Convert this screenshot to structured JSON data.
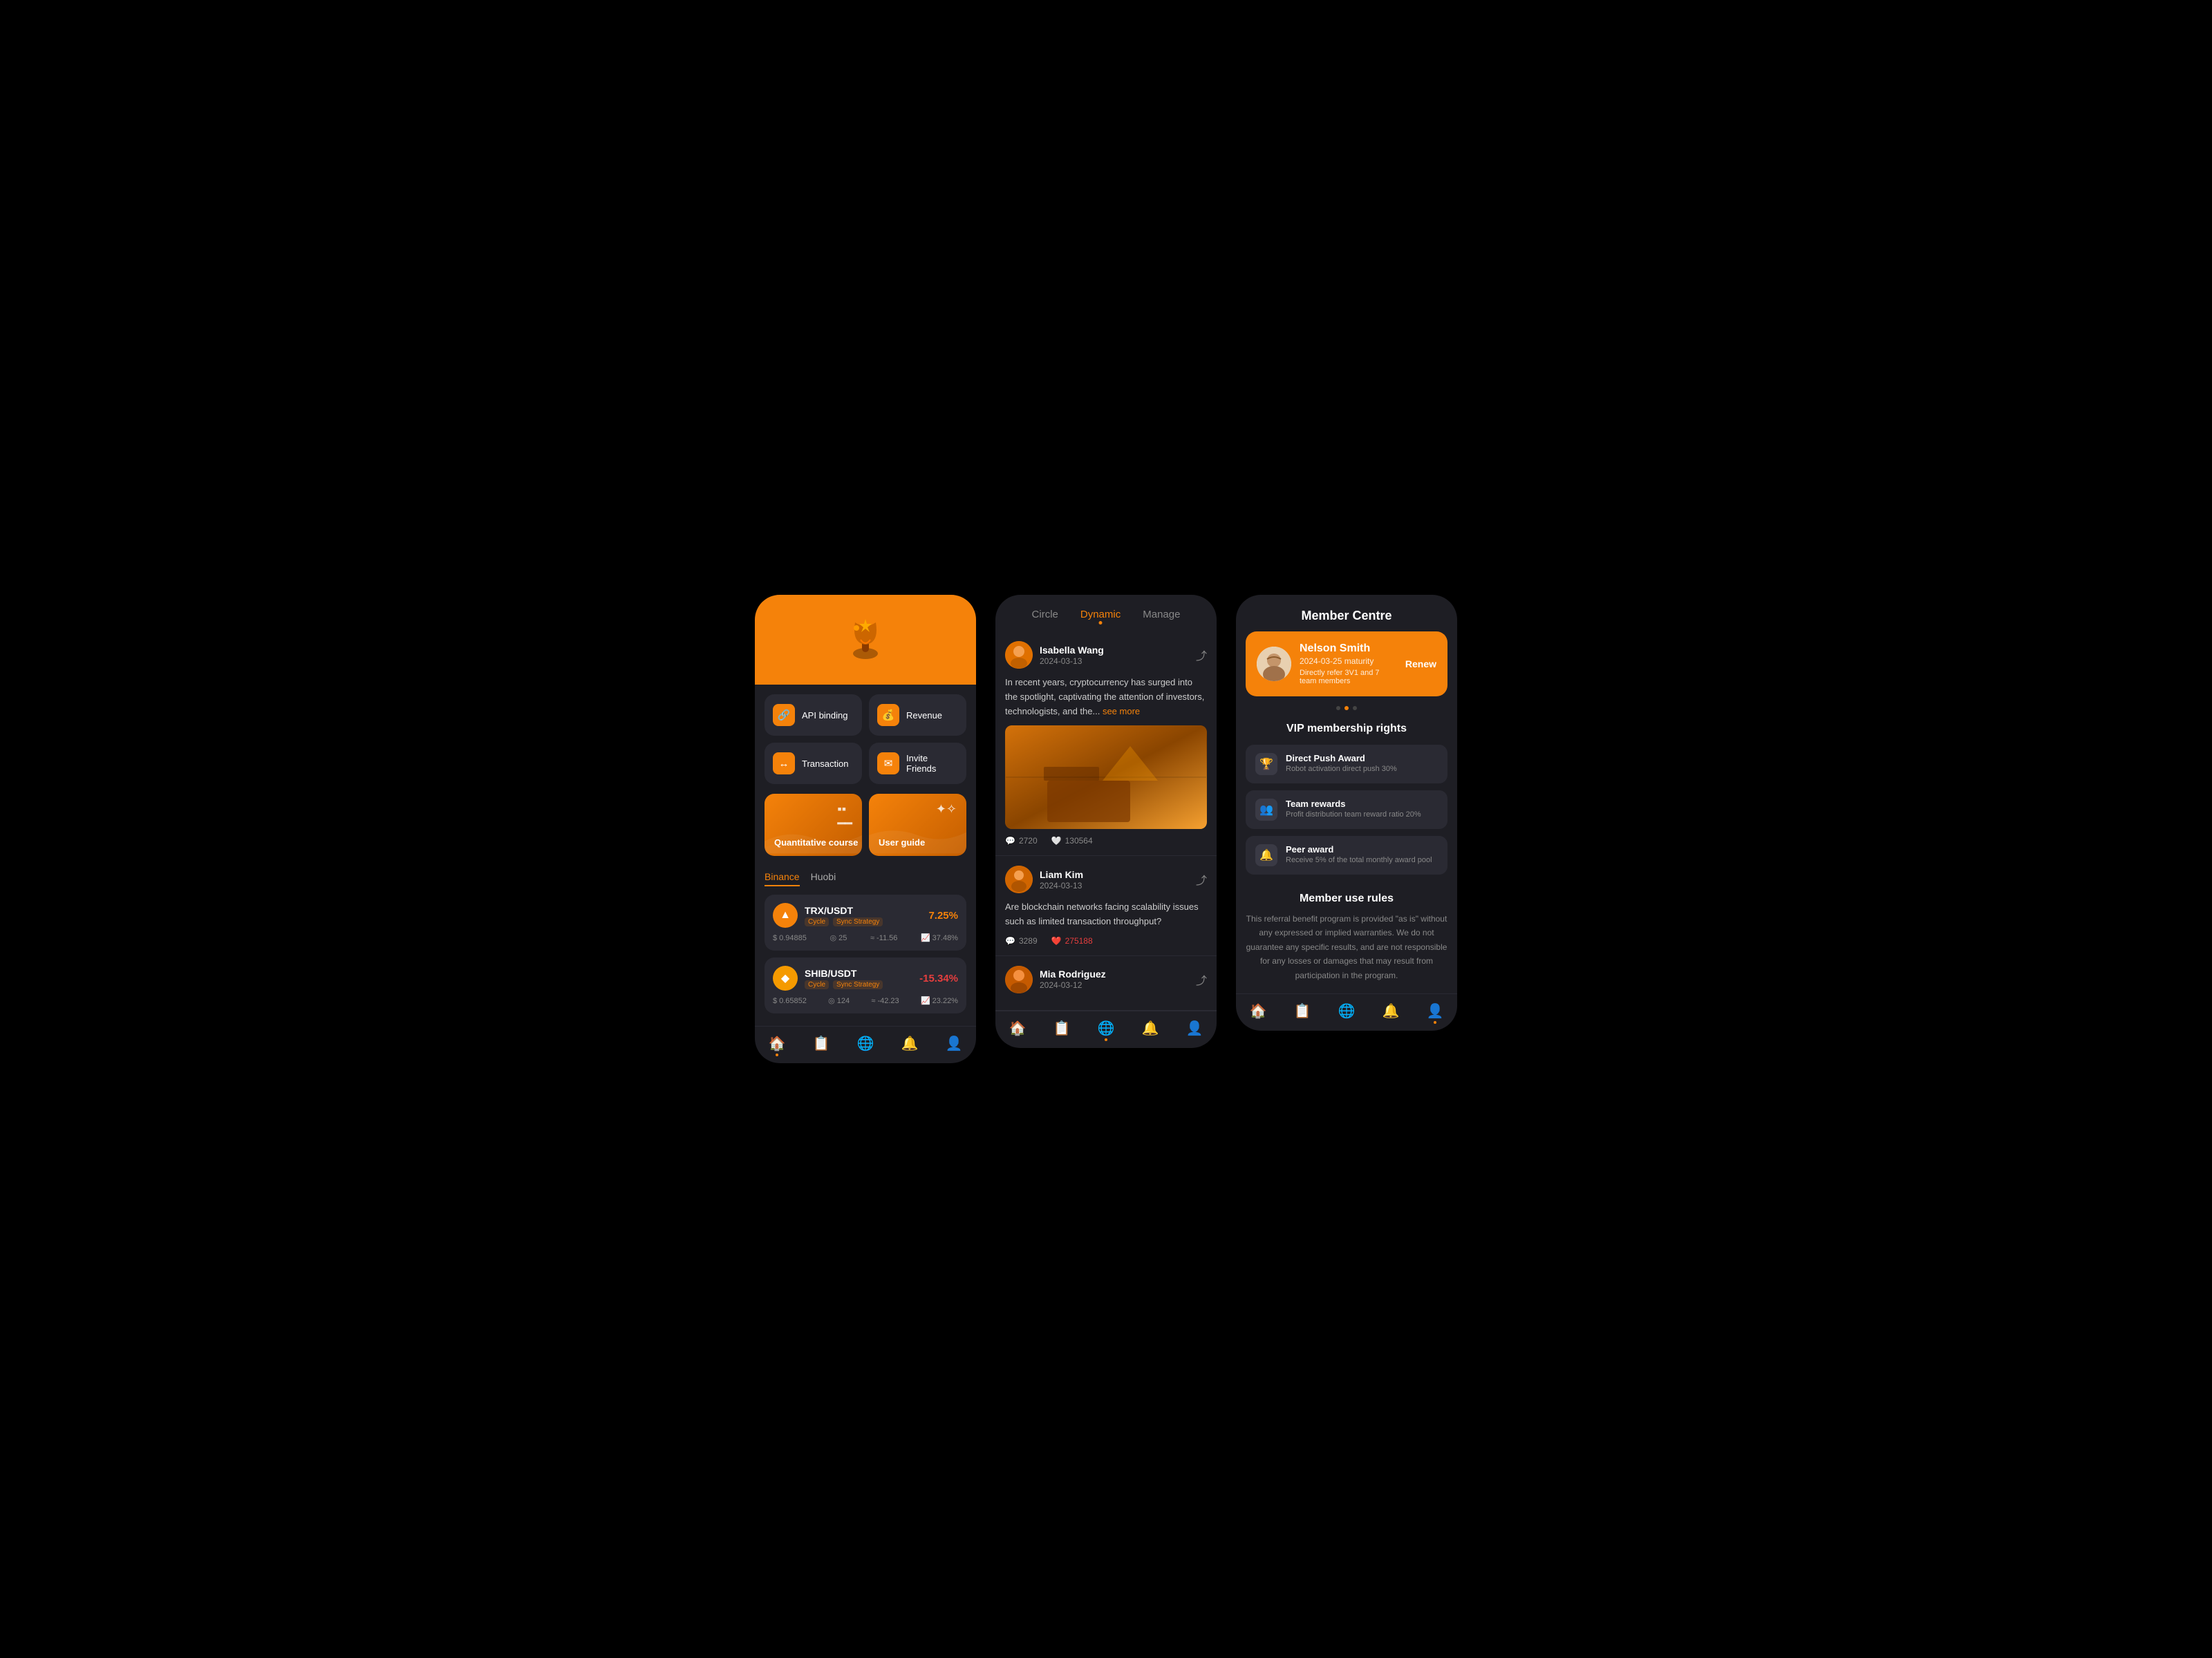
{
  "screen1": {
    "grid": {
      "items": [
        {
          "label": "API binding",
          "icon": "🔗"
        },
        {
          "label": "Revenue",
          "icon": "💰"
        },
        {
          "label": "Transaction",
          "icon": "↔"
        },
        {
          "label": "Invite Friends",
          "icon": "✉"
        }
      ]
    },
    "cards": [
      {
        "label": "Quantitative course"
      },
      {
        "label": "User guide"
      }
    ],
    "tabs": [
      {
        "label": "Binance",
        "active": true
      },
      {
        "label": "Huobi",
        "active": false
      }
    ],
    "trades": [
      {
        "name": "TRX/USDT",
        "tags": [
          "Cycle",
          "Sync Strategy"
        ],
        "pct": "7.25%",
        "pct_type": "pos",
        "stats": [
          "0.94885",
          "25",
          "-11.56",
          "37.48%"
        ]
      },
      {
        "name": "SHIB/USDT",
        "tags": [
          "Cycle",
          "Sync Strategy"
        ],
        "pct": "-15.34%",
        "pct_type": "neg",
        "stats": [
          "0.65852",
          "124",
          "-42.23",
          "23.22%"
        ]
      }
    ],
    "nav": [
      "🏠",
      "📋",
      "🌐",
      "🔔",
      "👤"
    ]
  },
  "screen2": {
    "tabs": [
      {
        "label": "Circle",
        "active": false
      },
      {
        "label": "Dynamic",
        "active": true
      },
      {
        "label": "Manage",
        "active": false
      }
    ],
    "posts": [
      {
        "user": "Isabella Wang",
        "date": "2024-03-13",
        "text": "In recent years, cryptocurrency has surged into the spotlight, captivating the attention of investors, technologists, and the...",
        "see_more": "see more",
        "has_image": true,
        "comments": "2720",
        "likes": "130564",
        "liked": false
      },
      {
        "user": "Liam Kim",
        "date": "2024-03-13",
        "text": "Are blockchain networks facing scalability issues such as limited transaction throughput?",
        "has_image": false,
        "comments": "3289",
        "likes": "275188",
        "liked": true
      },
      {
        "user": "Mia Rodriguez",
        "date": "2024-03-12",
        "text": "",
        "has_image": false,
        "comments": "",
        "likes": "",
        "liked": false
      }
    ],
    "nav": [
      "🏠",
      "📋",
      "🌐",
      "🔔",
      "👤"
    ]
  },
  "screen3": {
    "title": "Member Centre",
    "member": {
      "name": "Nelson Smith",
      "date": "2024-03-25 maturity",
      "sub": "Directly refer 3V1 and 7 team members",
      "renew": "Renew"
    },
    "vip_title": "VIP membership rights",
    "rights": [
      {
        "icon": "🏆",
        "title": "Direct Push Award",
        "desc": "Robot activation direct push 30%"
      },
      {
        "icon": "👥",
        "title": "Team rewards",
        "desc": "Profit distribution team reward ratio 20%"
      },
      {
        "icon": "🔔",
        "title": "Peer award",
        "desc": "Receive 5% of the total monthly award pool"
      }
    ],
    "rules_title": "Member use rules",
    "rules_text": "This referral benefit program is provided \"as is\" without any expressed or implied warranties. We do not guarantee any specific results, and are not responsible for any losses or damages that may result from participation in the program.",
    "nav": [
      "🏠",
      "📋",
      "🌐",
      "🔔",
      "👤"
    ]
  }
}
